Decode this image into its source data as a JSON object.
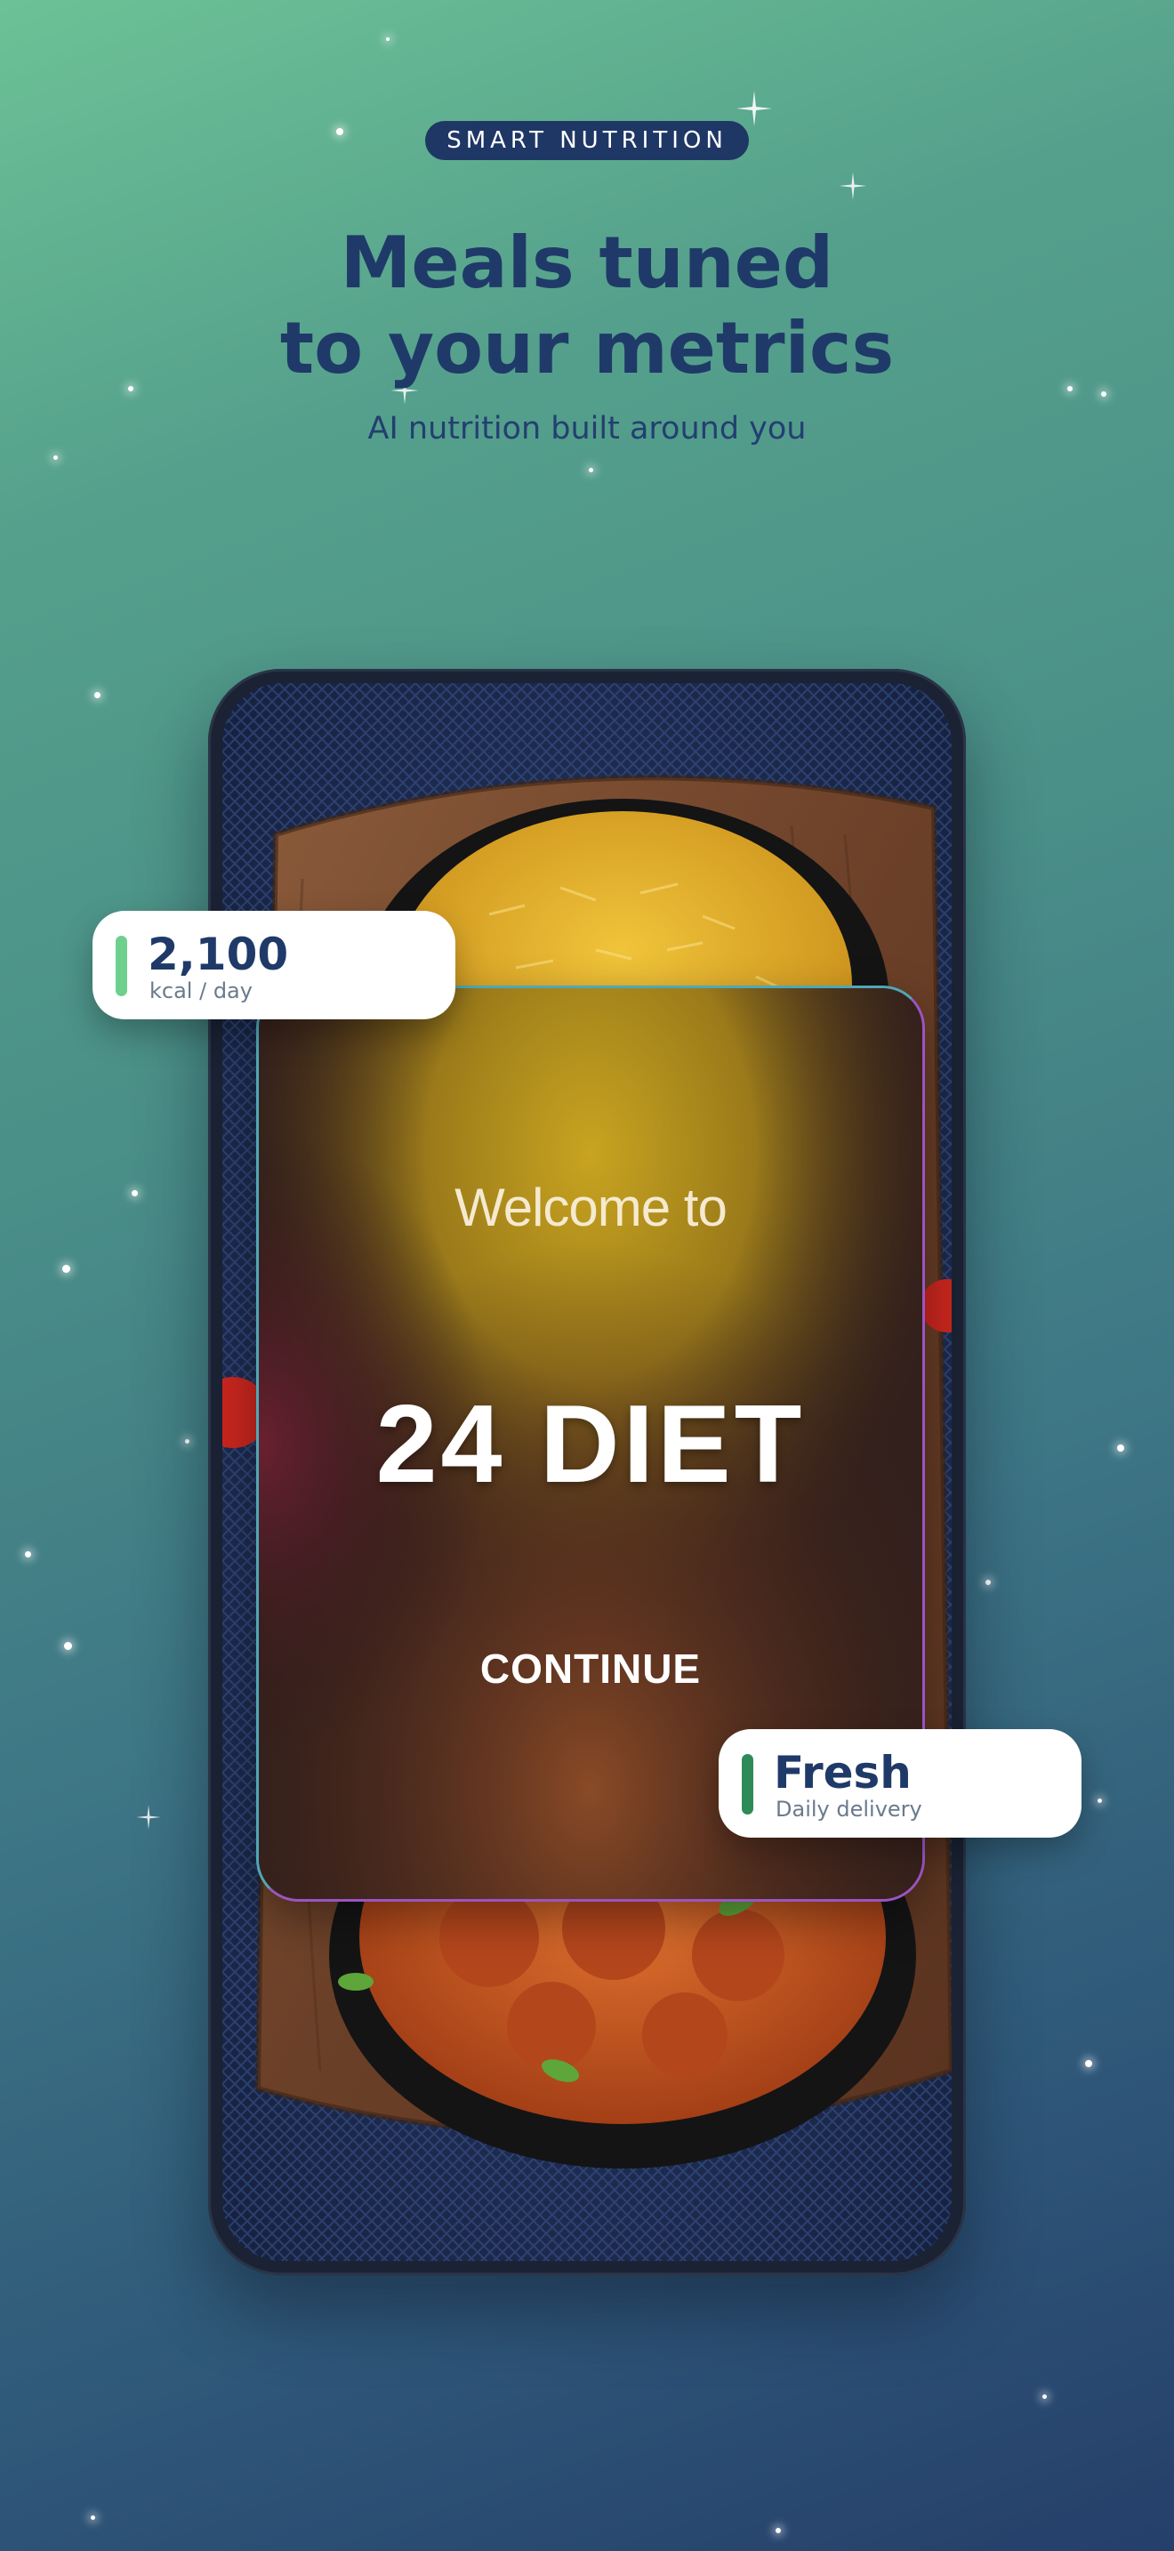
{
  "header": {
    "badge": "SMART NUTRITION",
    "headline_line1": "Meals tuned",
    "headline_line2": "to your metrics",
    "subheadline": "AI nutrition built around you"
  },
  "welcome": {
    "greeting": "Welcome to",
    "brand": "24 DIET",
    "continue_label": "CONTINUE"
  },
  "stats": [
    {
      "value": "2,100",
      "label": "kcal / day",
      "accent": "#6fd08e"
    },
    {
      "value": "Fresh",
      "label": "Daily delivery",
      "accent": "#2e8b57"
    }
  ],
  "colors": {
    "navy": "#1f3a68",
    "background_top": "#6cc296",
    "background_bottom": "#253f6a"
  }
}
